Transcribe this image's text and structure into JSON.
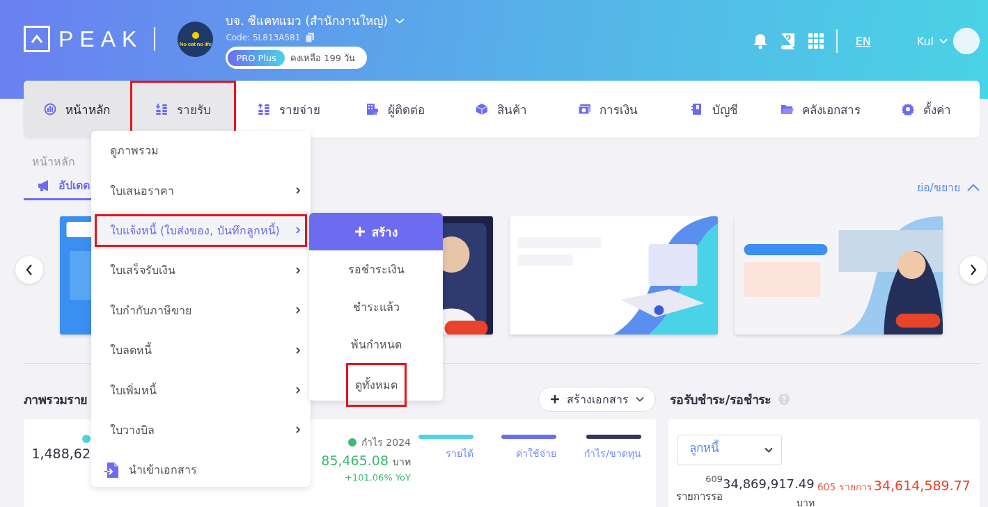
{
  "header": {
    "logo": "PEAK",
    "company_logo_text": "No cat no life",
    "company_name": "บจ. ซีแคทแมว (สำนักงานใหญ่)",
    "code": "Code: 5L813A581",
    "plan": "PRO Plus",
    "remaining": "คงเหลือ 199 วัน",
    "language": "EN",
    "user": "Kul"
  },
  "nav": [
    {
      "label": "หน้าหลัก",
      "selected": true,
      "open": false,
      "highlighted": false
    },
    {
      "label": "รายรับ",
      "selected": false,
      "open": true,
      "highlighted": true
    },
    {
      "label": "รายจ่าย",
      "selected": false,
      "open": false,
      "highlighted": false
    },
    {
      "label": "ผู้ติดต่อ",
      "selected": false,
      "open": false,
      "highlighted": false
    },
    {
      "label": "สินค้า",
      "selected": false,
      "open": false,
      "highlighted": false
    },
    {
      "label": "การเงิน",
      "selected": false,
      "open": false,
      "highlighted": false
    },
    {
      "label": "บัญชี",
      "selected": false,
      "open": false,
      "highlighted": false
    },
    {
      "label": "คลังเอกสาร",
      "selected": false,
      "open": false,
      "highlighted": false
    },
    {
      "label": "ตั้งค่า",
      "selected": false,
      "open": false,
      "highlighted": false
    }
  ],
  "breadcrumb": "หน้าหลัก",
  "updates_tab": {
    "label": "อัปเดต",
    "selected": true
  },
  "collapse": "ย่อ/ขยาย",
  "overview": {
    "title": "ภาพรวมราย",
    "create_button": "สร้างเอกสาร",
    "stats": [
      {
        "color": "#4dd4e3",
        "value": "1,488,62"
      },
      {
        "color": "#3dba6f",
        "label": "กำไร 2024",
        "value": "85,465.08",
        "unit": "บาท",
        "change": "+101.06% YoY"
      }
    ],
    "legend": [
      {
        "label": "รายได้",
        "color": "#4dd4e3"
      },
      {
        "label": "ค่าใช้จ่าย",
        "color": "#6c6cf0"
      },
      {
        "label": "กำไร/ขาดทุน",
        "color": "#33355a"
      }
    ]
  },
  "payments": {
    "title": "รอรับชำระ/รอชำระ",
    "filter": "ลูกหนี้",
    "receivable_count": "609",
    "receivable_count_label": "รายการรอ",
    "receivable_amount": "34,869,917.49",
    "receivable_unit": "บาท",
    "payable_count": "605 รายการ",
    "payable_amount": "34,614,589.77"
  },
  "menu": {
    "items": [
      {
        "label": "ดูภาพรวม",
        "kind": "link",
        "hovered": false,
        "highlighted": false
      },
      {
        "label": "ใบเสนอราคา",
        "kind": "submenu",
        "hovered": false,
        "highlighted": false
      },
      {
        "label": "ใบแจ้งหนี้ (ใบส่งของ, บันทึกลูกหนี้)",
        "kind": "submenu",
        "hovered": true,
        "highlighted": true
      },
      {
        "label": "ใบเสร็จรับเงิน",
        "kind": "submenu",
        "hovered": false,
        "highlighted": false
      },
      {
        "label": "ใบกำกับภาษีขาย",
        "kind": "submenu",
        "hovered": false,
        "highlighted": false
      },
      {
        "label": "ใบลดหนี้",
        "kind": "submenu",
        "hovered": false,
        "highlighted": false
      },
      {
        "label": "ใบเพิ่มหนี้",
        "kind": "submenu",
        "hovered": false,
        "highlighted": false
      },
      {
        "label": "ใบวางบิล",
        "kind": "submenu",
        "hovered": false,
        "highlighted": false
      },
      {
        "label": "นำเข้าเอกสาร",
        "kind": "import",
        "hovered": false,
        "highlighted": false
      }
    ]
  },
  "submenu": {
    "create": "สร้าง",
    "items": [
      {
        "label": "รอชำระเงิน",
        "highlighted": false
      },
      {
        "label": "ชำระแล้ว",
        "highlighted": false
      },
      {
        "label": "พ้นกำหนด",
        "highlighted": false
      },
      {
        "label": "ดูทั้งหมด",
        "highlighted": true
      }
    ]
  }
}
